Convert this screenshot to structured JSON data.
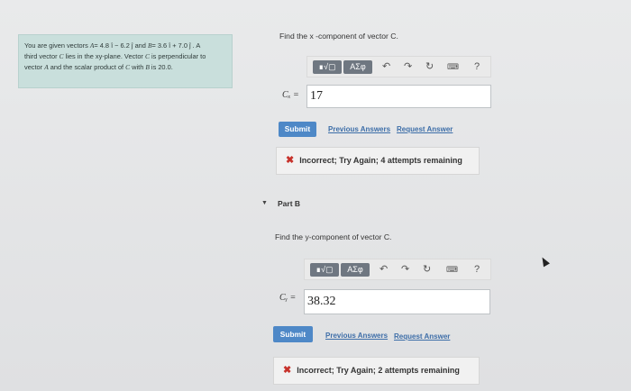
{
  "problem": {
    "line1_a": "You are given vectors ",
    "vecA": "A",
    "line1_b": "= 4.8 î − 6.2 ĵ and ",
    "vecB": "B",
    "line1_c": "= 3.6 î + 7.0 ĵ . A",
    "line2_a": "third vector ",
    "vecC": "C",
    "line2_b": " lies in the xy-plane. Vector ",
    "line2_c": " is perpendicular to",
    "line3_a": "vector ",
    "line3_b": " and the scalar product of ",
    "line3_c": " with ",
    "line3_d": " is 20.0."
  },
  "part_a": {
    "prompt": "Find the x -component of vector C.",
    "toolbar": {
      "btn1": "∎√▢",
      "btn2": "ΑΣφ",
      "help": "?"
    },
    "answer_label": "Cₓ =",
    "answer_value": "17",
    "submit_label": "Submit",
    "previous_answers": "Previous Answers",
    "request_answer": "Request Answer",
    "feedback": "Incorrect; Try Again; 4 attempts remaining"
  },
  "part_b": {
    "title": "Part B",
    "prompt": "Find the y-component of vector C.",
    "toolbar": {
      "btn1": "∎√▢",
      "btn2": "ΑΣφ",
      "help": "?"
    },
    "answer_label": "Cᵧ =",
    "answer_value": "38.32",
    "submit_label": "Submit",
    "previous_answers": "Previous Answers",
    "request_answer": "Request Answer",
    "feedback": "Incorrect; Try Again; 2 attempts remaining"
  },
  "colors": {
    "accent": "#4e88c7",
    "error": "#c7322b",
    "panel": "#c9dfdc"
  }
}
